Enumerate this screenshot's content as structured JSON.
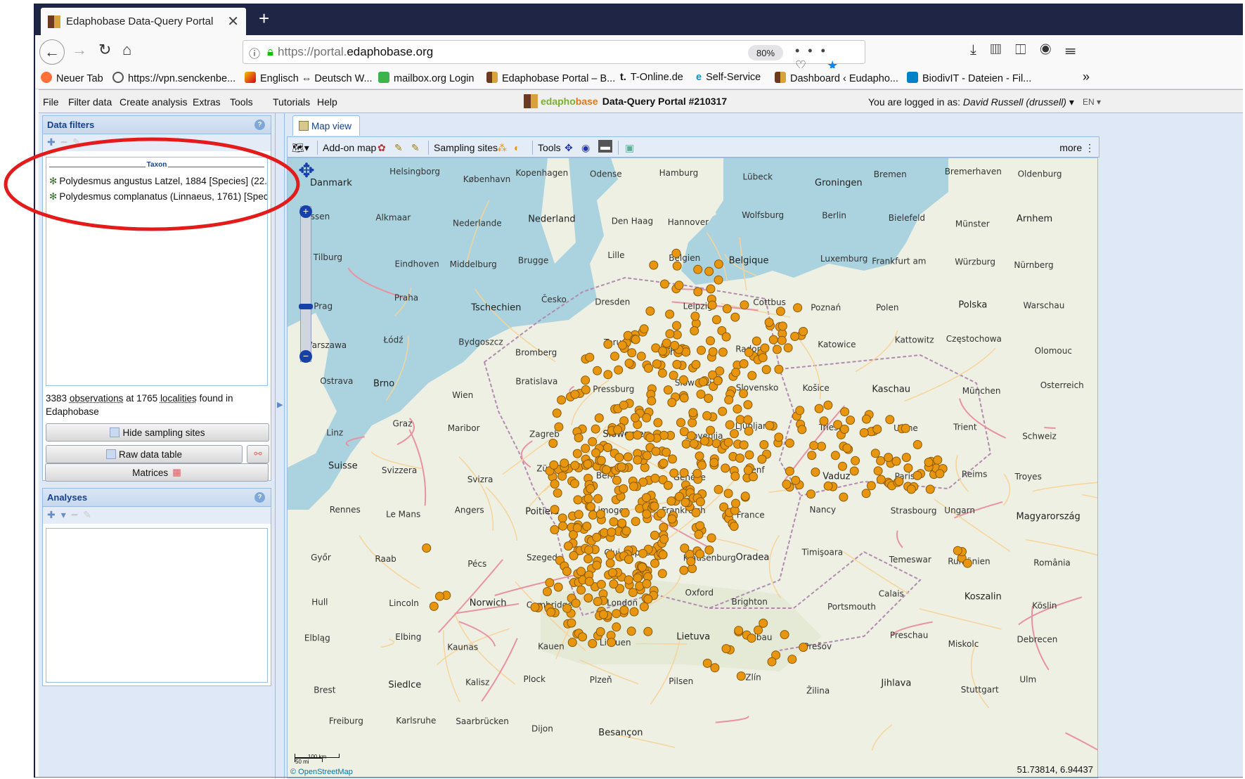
{
  "browser": {
    "tab_title": "Edaphobase Data-Query Portal",
    "url_prefix": "https://portal.",
    "url_domain": "edaphobase.org",
    "zoom": "80%",
    "bookmarks": [
      "Neuer Tab",
      "https://vpn.senckenbe...",
      "Englisch ⇔ Deutsch W...",
      "mailbox.org Login",
      "Edaphobase Portal – B...",
      "T-Online.de",
      "Self-Service",
      "Dashboard ‹ Eudapho...",
      "BiodivIT - Dateien - Fil..."
    ]
  },
  "app": {
    "menu": [
      "File",
      "Filter data",
      "Create analysis",
      "Extras",
      "Tools",
      "Tutorials",
      "Help"
    ],
    "title_brand_1": "edapho",
    "title_brand_2": "base",
    "title_rest": "Data-Query Portal #210317",
    "login_prefix": "You are logged in as:",
    "login_user": "David Russell (drussell)",
    "language": "EN"
  },
  "filters": {
    "title": "Data filters",
    "legend": "Taxon",
    "taxa": [
      "Polydesmus angustus Latzel, 1884 [Species] (22...",
      "Polydesmus complanatus (Linnaeus, 1761) [Speci..."
    ],
    "summary_count_obs": "3383",
    "summary_obs": "observations",
    "summary_at": "at 1765",
    "summary_loc": "localities",
    "summary_tail": "found in Edaphobase",
    "btn_hide": "Hide sampling sites",
    "btn_raw": "Raw data table",
    "btn_matrices": "Matrices"
  },
  "analyses": {
    "title": "Analyses"
  },
  "map": {
    "tab": "Map view",
    "toolbar_addon": "Add-on map",
    "toolbar_sites": "Sampling sites",
    "toolbar_tools": "Tools",
    "toolbar_more": "more",
    "attribution": "© OpenStreetMap",
    "coords": "51.73814, 6.94437",
    "scale_km": "100 km",
    "scale_mi": "50 mi",
    "point_color": "#e8950f",
    "places": [
      "Danmark",
      "Helsingborg",
      "København",
      "Kopenhagen",
      "Odense",
      "Hamburg",
      "Lübeck",
      "Groningen",
      "Bremen",
      "Bremerhaven",
      "Oldenburg",
      "Assen",
      "Alkmaar",
      "Nederlande",
      "Nederland",
      "Den Haag",
      "Hannover",
      "Wolfsburg",
      "Berlin",
      "Bielefeld",
      "Münster",
      "Arnhem",
      "Tilburg",
      "Eindhoven",
      "Middelburg",
      "Brugge",
      "Lille",
      "Belgien",
      "Belgique",
      "Luxemburg",
      "Frankfurt am",
      "Würzburg",
      "Nürnberg",
      "Prag",
      "Praha",
      "Tschechien",
      "Česko",
      "Dresden",
      "Leipzig",
      "Cottbus",
      "Poznań",
      "Polen",
      "Polska",
      "Warschau",
      "Warszawa",
      "Łódź",
      "Bydgoszcz",
      "Bromberg",
      "Toruń",
      "Thorn",
      "Radom",
      "Katowice",
      "Kattowitz",
      "Częstochowa",
      "Olomouc",
      "Ostrava",
      "Brno",
      "Wien",
      "Bratislava",
      "Pressburg",
      "Slowakei",
      "Slovensko",
      "Košice",
      "Kaschau",
      "München",
      "Osterreich",
      "Linz",
      "Graz",
      "Maribor",
      "Zagreb",
      "Slowenien",
      "Slovenija",
      "Ljubljana",
      "Trieste",
      "Udine",
      "Trient",
      "Schweiz",
      "Suisse",
      "Svizzera",
      "Svizra",
      "Zürich",
      "Bern",
      "Genève",
      "Genf",
      "Vaduz",
      "Paris",
      "Reims",
      "Troyes",
      "Rennes",
      "Le Mans",
      "Angers",
      "Poitiers",
      "Limoges",
      "Frankreich",
      "France",
      "Nancy",
      "Strasbourg",
      "Ungarn",
      "Magyarország",
      "Győr",
      "Raab",
      "Pécs",
      "Szeged",
      "Cluj-Napoca",
      "Klausenburg",
      "Oradea",
      "Timişoara",
      "Temeswar",
      "Rumänien",
      "România",
      "Hull",
      "Lincoln",
      "Norwich",
      "Cambridge",
      "London",
      "Oxford",
      "Brighton",
      "Portsmouth",
      "Calais",
      "Koszalin",
      "Köslin",
      "Elbląg",
      "Elbing",
      "Kaunas",
      "Kauen",
      "Litauen",
      "Lietuva",
      "Libau",
      "Prešov",
      "Preschau",
      "Miskolc",
      "Debrecen",
      "Brest",
      "Siedlce",
      "Kalisz",
      "Plock",
      "Plzeň",
      "Pilsen",
      "Zlín",
      "Žilina",
      "Jihlava",
      "Stuttgart",
      "Ulm",
      "Freiburg",
      "Karlsruhe",
      "Saarbrücken",
      "Dijon",
      "Besançon"
    ]
  }
}
